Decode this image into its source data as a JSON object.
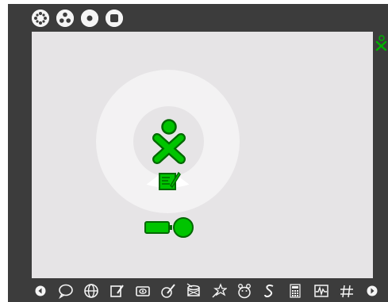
{
  "colors": {
    "frame": "#3c3c3c",
    "desktop": "#e6e4e6",
    "ring": "#f3f2f3",
    "xo_fill": "#00c400",
    "xo_stroke": "#00a000",
    "toolbar_icon": "#f5f5f5"
  },
  "top_bar": {
    "items": [
      {
        "icon": "neighborhood-view-icon"
      },
      {
        "icon": "group-view-icon"
      },
      {
        "icon": "home-view-icon"
      },
      {
        "icon": "activity-view-icon"
      }
    ]
  },
  "home": {
    "owner_icon": "xo-buddy-icon",
    "activity_icon": "write-activity-icon",
    "battery_icon": "battery-icon",
    "side_icon": "friend-xo-icon"
  },
  "bottom_bar": {
    "items": [
      "scroll-left-icon",
      "chat-activity-icon",
      "browse-activity-icon",
      "write-activity-icon",
      "record-activity-icon",
      "paint-activity-icon",
      "tamtam-activity-icon",
      "turtleart-activity-icon",
      "etoys-activity-icon",
      "speak-activity-icon",
      "calculate-activity-icon",
      "measure-activity-icon",
      "distance-activity-icon",
      "scroll-right-icon"
    ]
  }
}
